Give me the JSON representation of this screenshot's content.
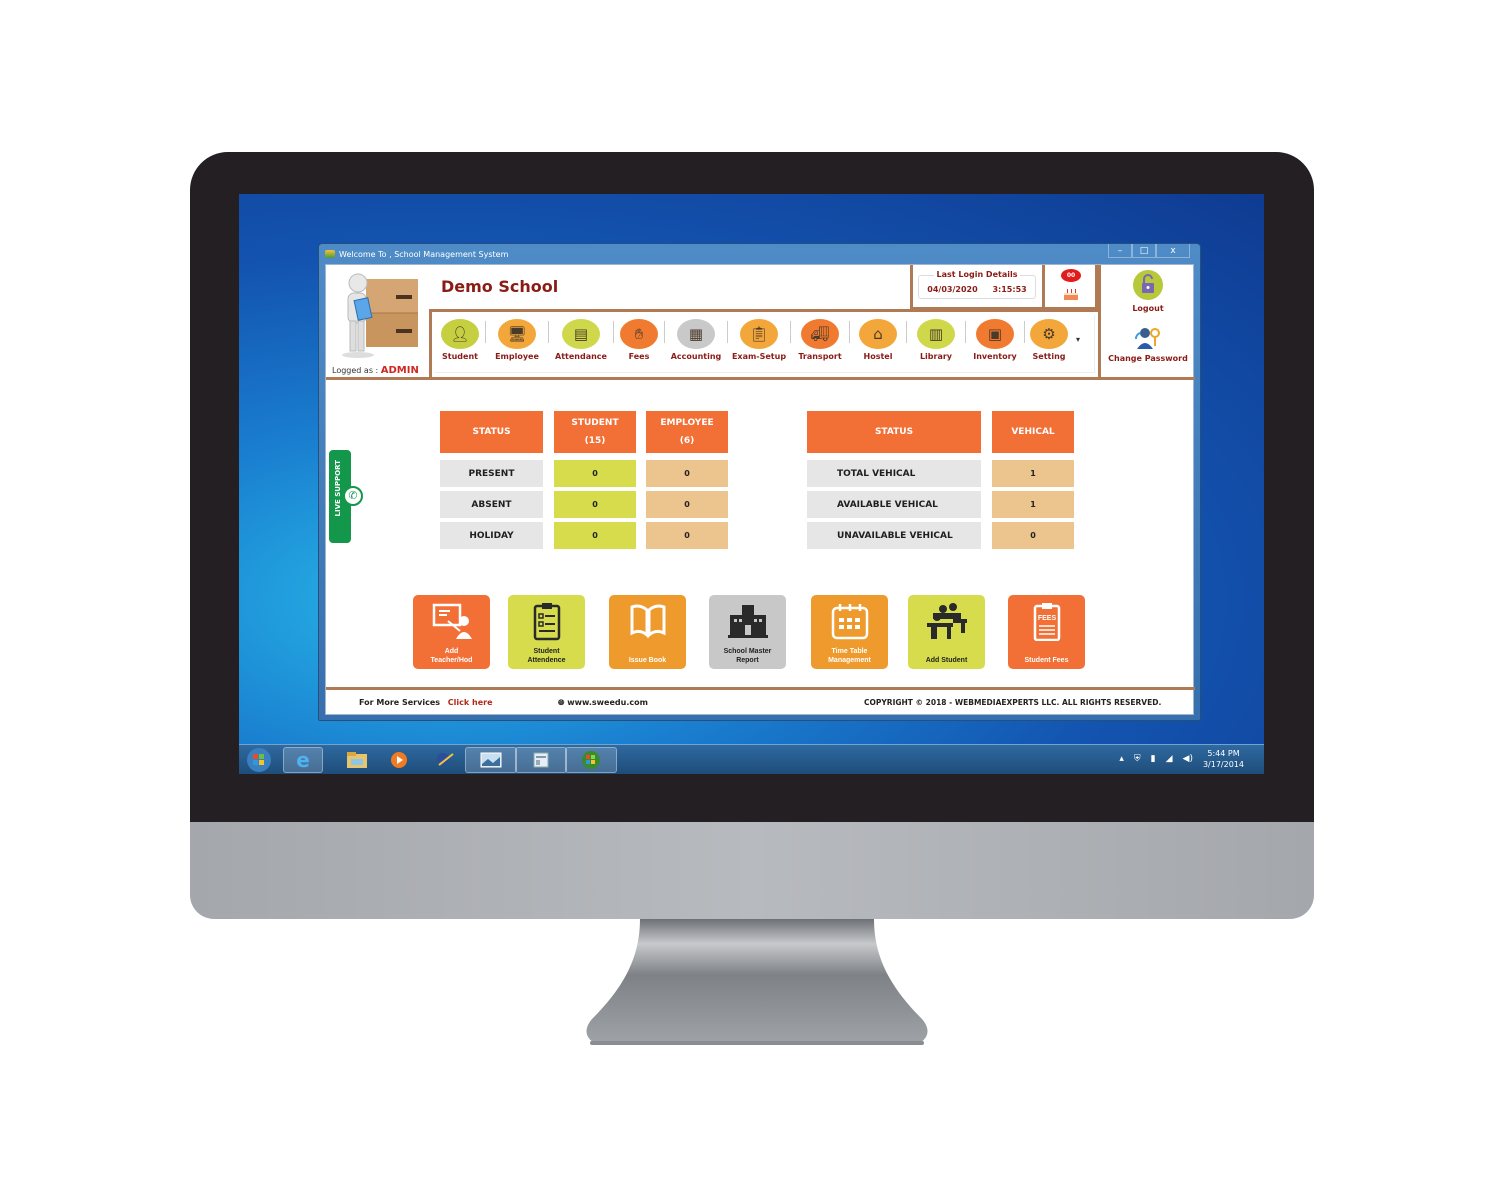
{
  "window": {
    "title": "Welcome To , School Management System",
    "controls": {
      "minimize": "–",
      "maximize": "□",
      "close": "x"
    }
  },
  "header": {
    "school_name": "Demo School",
    "logged_as_label": "Logged as :",
    "logged_as_user": "ADMIN",
    "last_login": {
      "label": "Last Login Details",
      "date": "04/03/2020",
      "time": "3:15:53"
    },
    "birthday_count": "00"
  },
  "nav": {
    "items": [
      {
        "label": "Student",
        "icon": "student-icon",
        "color": "#c5cf3f"
      },
      {
        "label": "Employee",
        "icon": "employee-icon",
        "color": "#f3a73a"
      },
      {
        "label": "Attendance",
        "icon": "attendance-icon",
        "color": "#cfd84a"
      },
      {
        "label": "Fees",
        "icon": "fees-icon",
        "color": "#f07a2f"
      },
      {
        "label": "Accounting",
        "icon": "accounting-icon",
        "color": "#c9c9c9"
      },
      {
        "label": "Exam-Setup",
        "icon": "exam-setup-icon",
        "color": "#f3a73a"
      },
      {
        "label": "Transport",
        "icon": "transport-icon",
        "color": "#f07a2f"
      },
      {
        "label": "Hostel",
        "icon": "hostel-icon",
        "color": "#f3a73a"
      },
      {
        "label": "Library",
        "icon": "library-icon",
        "color": "#cfd84a"
      },
      {
        "label": "Inventory",
        "icon": "inventory-icon",
        "color": "#f07a2f"
      },
      {
        "label": "Setting",
        "icon": "setting-icon",
        "color": "#f3a73a"
      }
    ],
    "more_glyph": "▾"
  },
  "side": {
    "logout_label": "Logout",
    "change_password_label": "Change Password"
  },
  "live_support": {
    "label": "LIVE SUPPORT"
  },
  "attendance_table": {
    "headers": [
      "STATUS",
      "STUDENT",
      "(15)",
      "EMPLOYEE",
      "(6)"
    ],
    "rows": [
      {
        "status": "PRESENT",
        "student": "0",
        "employee": "0"
      },
      {
        "status": "ABSENT",
        "student": "0",
        "employee": "0"
      },
      {
        "status": "HOLIDAY",
        "student": "0",
        "employee": "0"
      }
    ]
  },
  "vehicle_table": {
    "headers": [
      "STATUS",
      "VEHICAL"
    ],
    "rows": [
      {
        "status": "TOTAL VEHICAL",
        "value": "1"
      },
      {
        "status": "AVAILABLE VEHICAL",
        "value": "1"
      },
      {
        "status": "UNAVAILABLE VEHICAL",
        "value": "0"
      }
    ]
  },
  "tiles": [
    {
      "line1": "Add",
      "line2": "Teacher/Hod",
      "icon": "teacher-board-icon",
      "bg": "#f26f35",
      "fg": "#ffffff"
    },
    {
      "line1": "Student",
      "line2": "Attendence",
      "icon": "clipboard-checklist-icon",
      "bg": "#d6dc4c",
      "fg": "#222222"
    },
    {
      "line1": "Issue Book",
      "line2": "",
      "icon": "open-book-icon",
      "bg": "#ef9a2c",
      "fg": "#ffffff"
    },
    {
      "line1": "School Master",
      "line2": "Report",
      "icon": "school-building-icon",
      "bg": "#c8c8c8",
      "fg": "#222222"
    },
    {
      "line1": "Time Table",
      "line2": "Management",
      "icon": "calendar-icon",
      "bg": "#ef9a2c",
      "fg": "#ffffff"
    },
    {
      "line1": "Add Student",
      "line2": "",
      "icon": "classroom-icon",
      "bg": "#d6dc4c",
      "fg": "#222222"
    },
    {
      "line1": "Student Fees",
      "line2": "",
      "icon": "fees-clipboard-icon",
      "bg": "#f26f35",
      "fg": "#ffffff"
    }
  ],
  "footer": {
    "more_services_label": "For More Services",
    "click_here": "Click here",
    "website": "www.sweedu.com",
    "copyright": "COPYRIGHT © 2018 - WEBMEDIAEXPERTS LLC. ALL RIGHTS RESERVED."
  },
  "taskbar": {
    "items": [
      "start-orb",
      "internet-explorer",
      "file-explorer",
      "media-player",
      "paint-app",
      "photo-viewer",
      "window-app",
      "windows-app"
    ],
    "tray_arrow": "▴",
    "time": "5:44 PM",
    "date": "3/17/2014"
  }
}
